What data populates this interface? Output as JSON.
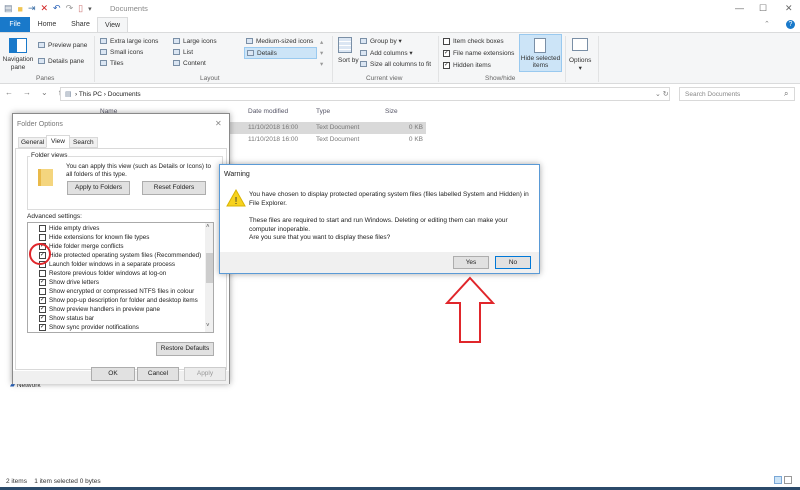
{
  "window": {
    "title": "Documents"
  },
  "tabs": [
    "File",
    "Home",
    "Share",
    "View"
  ],
  "ribbon": {
    "panes": {
      "navigation_pane": "Navigation pane",
      "preview_pane": "Preview pane",
      "details_pane": "Details pane",
      "label": "Panes"
    },
    "layout": {
      "items": [
        "Extra large icons",
        "Small icons",
        "Tiles",
        "Large icons",
        "List",
        "Content",
        "Medium-sized icons",
        "Details"
      ],
      "selected": "Details",
      "label": "Layout"
    },
    "current_view": {
      "sort_by": "Sort by",
      "group_by": "Group by",
      "add_columns": "Add columns",
      "size_columns": "Size all columns to fit",
      "label": "Current view"
    },
    "show_hide": {
      "item_check_boxes": "Item check boxes",
      "file_name_extensions": "File name extensions",
      "hidden_items": "Hidden items",
      "checks": [
        false,
        true,
        true
      ],
      "hide_selected": "Hide selected items",
      "label": "Show/hide"
    },
    "options": "Options"
  },
  "address": {
    "crumbs": [
      "This PC",
      "Documents"
    ],
    "search_placeholder": "Search Documents"
  },
  "columns": [
    "Name",
    "Date modified",
    "Type",
    "Size"
  ],
  "files": [
    {
      "date": "11/10/2018 16:00",
      "type": "Text Document",
      "size": "0 KB"
    },
    {
      "date": "11/10/2018 16:00",
      "type": "Text Document",
      "size": "0 KB"
    }
  ],
  "nav": {
    "network": "Network"
  },
  "status": {
    "items": "2 items",
    "selected": "1 item selected  0 bytes"
  },
  "folder_options": {
    "title": "Folder Options",
    "tabs": [
      "General",
      "View",
      "Search"
    ],
    "folder_views_label": "Folder views",
    "folder_views_text": "You can apply this view (such as Details or Icons) to all folders of this type.",
    "apply_to_folders": "Apply to Folders",
    "reset_folders": "Reset Folders",
    "advanced_label": "Advanced settings:",
    "settings": [
      {
        "label": "Hide empty drives",
        "checked": false
      },
      {
        "label": "Hide extensions for known file types",
        "checked": false
      },
      {
        "label": "Hide folder merge conflicts",
        "checked": true
      },
      {
        "label": "Hide protected operating system files (Recommended)",
        "checked": true
      },
      {
        "label": "Launch folder windows in a separate process",
        "checked": false
      },
      {
        "label": "Restore previous folder windows at log-on",
        "checked": false
      },
      {
        "label": "Show drive letters",
        "checked": true
      },
      {
        "label": "Show encrypted or compressed NTFS files in colour",
        "checked": false
      },
      {
        "label": "Show pop-up description for folder and desktop items",
        "checked": true
      },
      {
        "label": "Show preview handlers in preview pane",
        "checked": true
      },
      {
        "label": "Show status bar",
        "checked": true
      },
      {
        "label": "Show sync provider notifications",
        "checked": true
      }
    ],
    "restore_defaults": "Restore Defaults",
    "ok": "OK",
    "cancel": "Cancel",
    "apply": "Apply"
  },
  "warning": {
    "title": "Warning",
    "line1": "You have chosen to display protected operating system files (files labelled System and Hidden) in File Explorer.",
    "line2": "These files are required to start and run Windows. Deleting or editing them can make your computer inoperable.",
    "line3": "Are you sure that you want to display these files?",
    "yes": "Yes",
    "no": "No"
  },
  "colors": {
    "accent": "#1979ca",
    "annotation": "#e0262b"
  }
}
